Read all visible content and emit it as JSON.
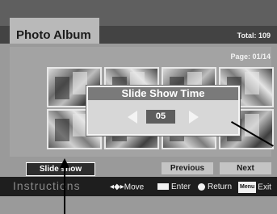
{
  "header": {
    "title": "Photo Album",
    "total": "Total: 109"
  },
  "page_indicator": "Page: 01/14",
  "dialog": {
    "title": "Slide Show Time",
    "value": "05"
  },
  "buttons": {
    "slide_show": "Slide show",
    "previous": "Previous",
    "next": "Next"
  },
  "instructions": {
    "label": "Instructions",
    "move": "Move",
    "enter": "Enter",
    "return": "Return",
    "menu_badge": "Menu",
    "exit": "Exit"
  },
  "icons": [
    "left-arrow-icon",
    "right-arrow-icon",
    "move-arrows-icon",
    "enter-icon",
    "return-icon",
    "menu-icon"
  ],
  "colors": {
    "active_button": "#2d2d2d",
    "dialog_title": "#7a7a7a"
  }
}
